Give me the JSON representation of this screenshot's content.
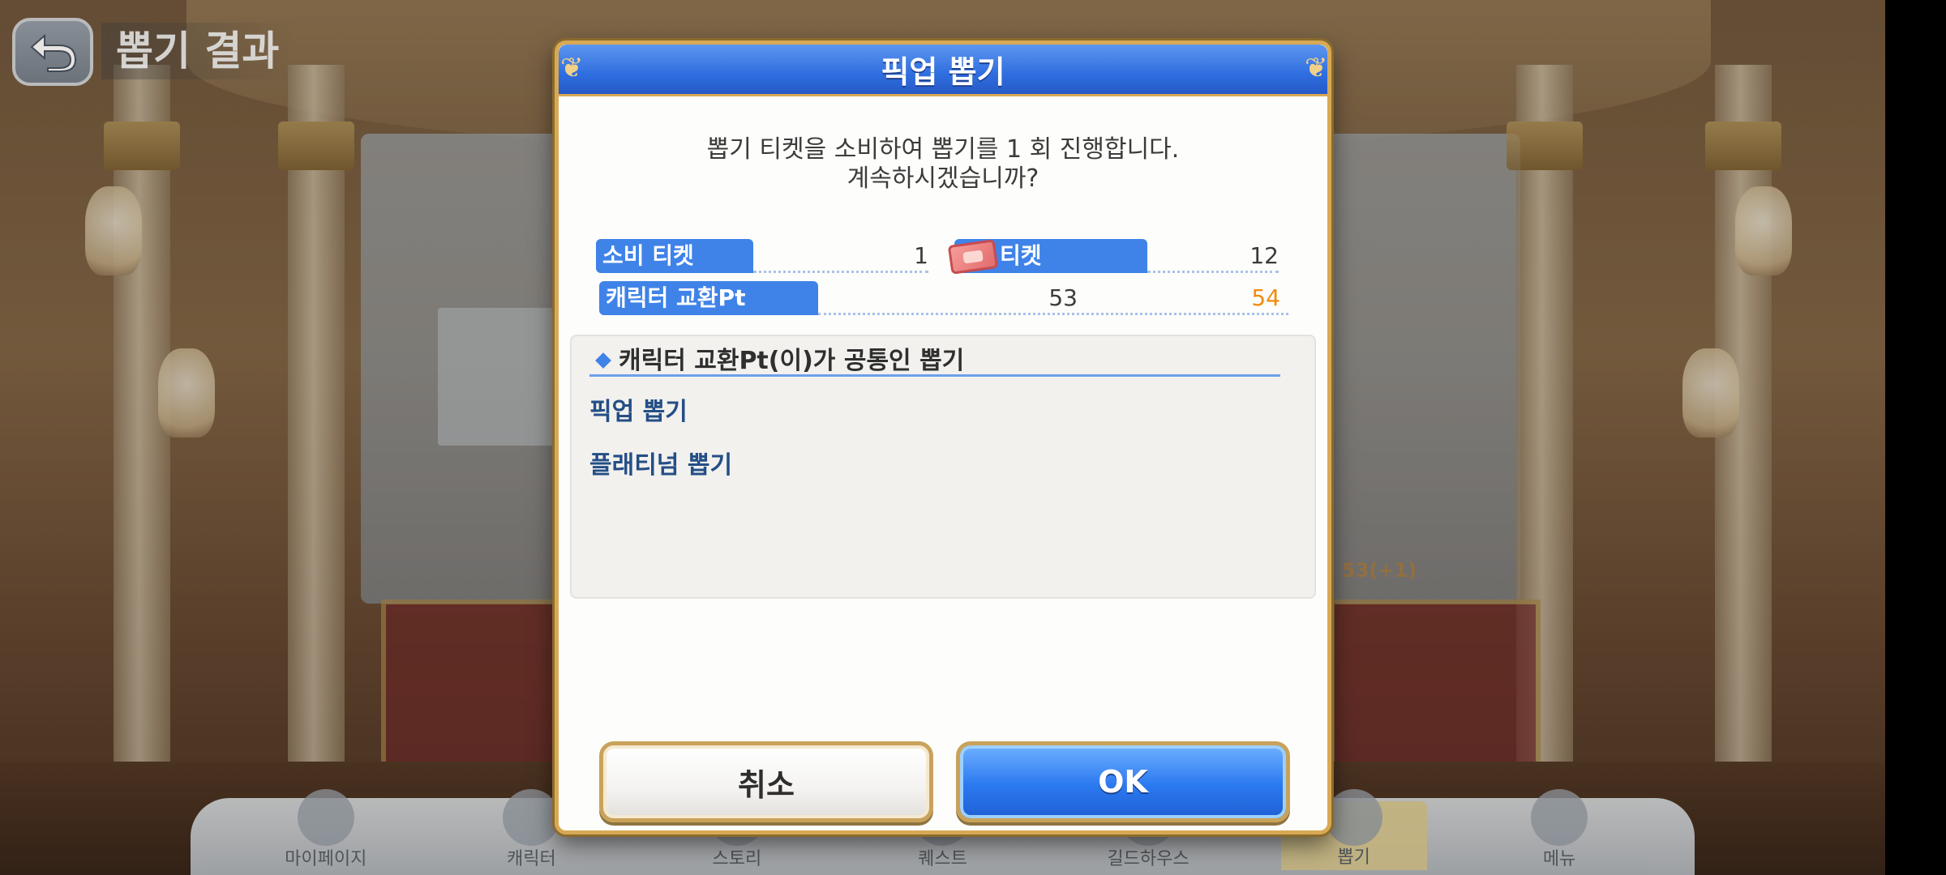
{
  "screen": {
    "page_title": "뽑기 결과",
    "bottom_tabs": [
      "마이페이지",
      "캐릭터",
      "스토리",
      "퀘스트",
      "길드하우스",
      "뽑기",
      "메뉴"
    ],
    "active_tab_index": 5,
    "background_sticker": "53(+1)"
  },
  "dialog": {
    "title": "픽업 뽑기",
    "message_line1": "뽑기 티켓을 소비하여 뽑기를 1 회 진행합니다.",
    "message_line2": "계속하시겠습니까?",
    "consume_ticket": {
      "label": "소비 티켓",
      "value": "1"
    },
    "owned_ticket": {
      "label": "티켓",
      "value": "12"
    },
    "exchange_pt": {
      "label": "캐릭터 교환Pt",
      "current": "53",
      "after": "54"
    },
    "info": {
      "heading": "캐릭터 교환Pt(이)가 공통인 뽑기",
      "items": [
        "픽업 뽑기",
        "플래티넘 뽑기"
      ]
    },
    "cancel_label": "취소",
    "ok_label": "OK"
  },
  "colors": {
    "header_blue": "#2f6ee0",
    "label_blue": "#3f83e8",
    "gold_border": "#d8a955",
    "highlight_orange": "#f08c10",
    "info_text": "#244e86"
  },
  "icons": [
    "back-arrow-icon",
    "ticket-icon",
    "diamond-bullet-icon"
  ]
}
